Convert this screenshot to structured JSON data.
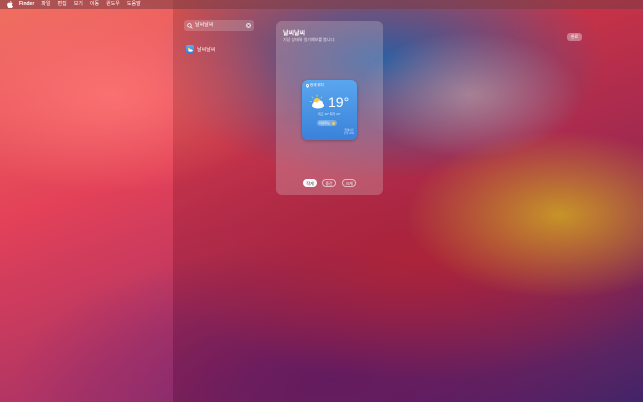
{
  "menubar": {
    "items": [
      "Finder",
      "파일",
      "편집",
      "보기",
      "이동",
      "윈도우",
      "도움말"
    ]
  },
  "search": {
    "query": "날씨날씨"
  },
  "results": {
    "items": [
      {
        "label": "날씨날씨",
        "icon": "weather-app-icon"
      }
    ]
  },
  "widget_panel": {
    "title": "날씨날씨",
    "subtitle": "기상 상태와 일기예보를 봅니다."
  },
  "weather": {
    "location": "현재 위치",
    "temperature": "19°",
    "minmax": "최고 19° 최저 13°",
    "forecast": "이번주는",
    "updated_line1": "업데이트",
    "updated_line2": "오후 4:11",
    "icon": "partly-cloudy-icon",
    "accent_color": "#3a82da"
  },
  "size_buttons": {
    "small": "작게",
    "medium": "중간",
    "large": "크게"
  },
  "done": {
    "label": "완료"
  }
}
